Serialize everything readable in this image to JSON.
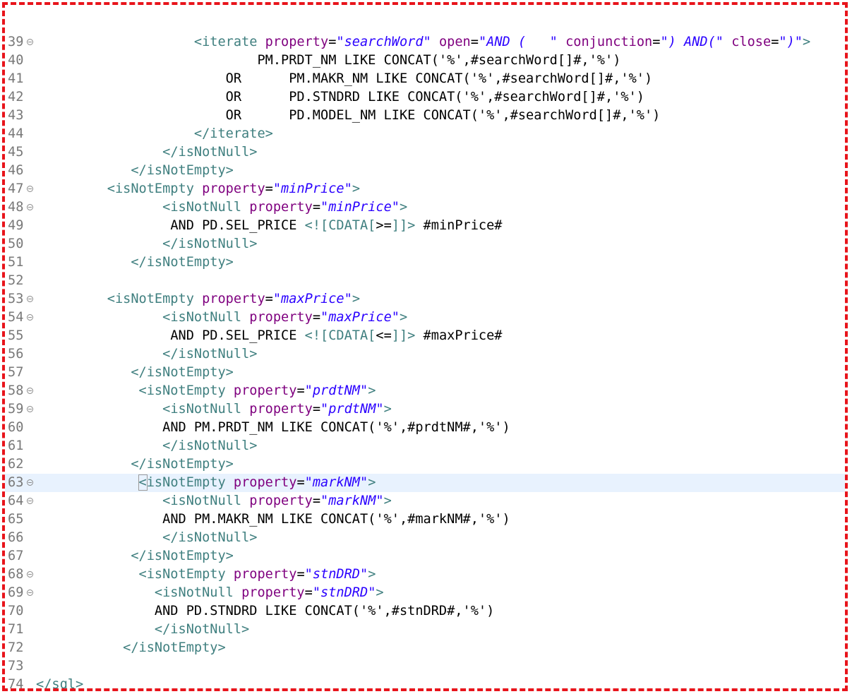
{
  "editor": {
    "language": "xml",
    "current_line": 63,
    "lines": [
      {
        "num": "39",
        "fold": true,
        "segs": [
          [
            "t",
            "<iterate "
          ],
          [
            "a",
            "property"
          ],
          [
            "x",
            "="
          ],
          [
            "v",
            "\"searchWord\""
          ],
          [
            "x",
            " "
          ],
          [
            "a",
            "open"
          ],
          [
            "x",
            "="
          ],
          [
            "v",
            "\"AND (   \""
          ],
          [
            "x",
            " "
          ],
          [
            "a",
            "conjunction"
          ],
          [
            "x",
            "="
          ],
          [
            "v",
            "\") AND(\""
          ],
          [
            "x",
            " "
          ],
          [
            "a",
            "close"
          ],
          [
            "x",
            "="
          ],
          [
            "v",
            "\")\""
          ],
          [
            "t",
            ">"
          ]
        ],
        "indent": "                    "
      },
      {
        "num": "40",
        "fold": false,
        "segs": [
          [
            "x",
            "PM.PRDT_NM LIKE CONCAT('%',#searchWord[]#,'%')"
          ]
        ],
        "indent": "                            "
      },
      {
        "num": "41",
        "fold": false,
        "segs": [
          [
            "x",
            "OR      PM.MAKR_NM LIKE CONCAT('%',#searchWord[]#,'%')"
          ]
        ],
        "indent": "                        "
      },
      {
        "num": "42",
        "fold": false,
        "segs": [
          [
            "x",
            "OR      PD.STNDRD LIKE CONCAT('%',#searchWord[]#,'%')"
          ]
        ],
        "indent": "                        "
      },
      {
        "num": "43",
        "fold": false,
        "segs": [
          [
            "x",
            "OR      PD.MODEL_NM LIKE CONCAT('%',#searchWord[]#,'%')"
          ]
        ],
        "indent": "                        "
      },
      {
        "num": "44",
        "fold": false,
        "segs": [
          [
            "t",
            "</iterate>"
          ]
        ],
        "indent": "                    "
      },
      {
        "num": "45",
        "fold": false,
        "segs": [
          [
            "t",
            "</isNotNull>"
          ]
        ],
        "indent": "                "
      },
      {
        "num": "46",
        "fold": false,
        "segs": [
          [
            "t",
            "</isNotEmpty>"
          ]
        ],
        "indent": "            "
      },
      {
        "num": "47",
        "fold": true,
        "segs": [
          [
            "t",
            "<isNotEmpty "
          ],
          [
            "a",
            "property"
          ],
          [
            "x",
            "="
          ],
          [
            "v",
            "\"minPrice\""
          ],
          [
            "t",
            ">"
          ]
        ],
        "indent": "         "
      },
      {
        "num": "48",
        "fold": true,
        "segs": [
          [
            "t",
            "<isNotNull "
          ],
          [
            "a",
            "property"
          ],
          [
            "x",
            "="
          ],
          [
            "v",
            "\"minPrice\""
          ],
          [
            "t",
            ">"
          ]
        ],
        "indent": "                "
      },
      {
        "num": "49",
        "fold": false,
        "segs": [
          [
            "x",
            "AND PD.SEL_PRICE "
          ],
          [
            "t",
            "<![CDATA["
          ],
          [
            "x",
            ">="
          ],
          [
            "t",
            "]]>"
          ],
          [
            "x",
            " #minPrice#"
          ]
        ],
        "indent": "                 "
      },
      {
        "num": "50",
        "fold": false,
        "segs": [
          [
            "t",
            "</isNotNull>"
          ]
        ],
        "indent": "                "
      },
      {
        "num": "51",
        "fold": false,
        "segs": [
          [
            "t",
            "</isNotEmpty>"
          ]
        ],
        "indent": "            "
      },
      {
        "num": "52",
        "fold": false,
        "segs": [],
        "indent": ""
      },
      {
        "num": "53",
        "fold": true,
        "segs": [
          [
            "t",
            "<isNotEmpty "
          ],
          [
            "a",
            "property"
          ],
          [
            "x",
            "="
          ],
          [
            "v",
            "\"maxPrice\""
          ],
          [
            "t",
            ">"
          ]
        ],
        "indent": "         "
      },
      {
        "num": "54",
        "fold": true,
        "segs": [
          [
            "t",
            "<isNotNull "
          ],
          [
            "a",
            "property"
          ],
          [
            "x",
            "="
          ],
          [
            "v",
            "\"maxPrice\""
          ],
          [
            "t",
            ">"
          ]
        ],
        "indent": "                "
      },
      {
        "num": "55",
        "fold": false,
        "segs": [
          [
            "x",
            "AND PD.SEL_PRICE "
          ],
          [
            "t",
            "<![CDATA["
          ],
          [
            "x",
            "<="
          ],
          [
            "t",
            "]]>"
          ],
          [
            "x",
            " #maxPrice#"
          ]
        ],
        "indent": "                 "
      },
      {
        "num": "56",
        "fold": false,
        "segs": [
          [
            "t",
            "</isNotNull>"
          ]
        ],
        "indent": "                "
      },
      {
        "num": "57",
        "fold": false,
        "segs": [
          [
            "t",
            "</isNotEmpty>"
          ]
        ],
        "indent": "            "
      },
      {
        "num": "58",
        "fold": true,
        "segs": [
          [
            "t",
            "<isNotEmpty "
          ],
          [
            "a",
            "property"
          ],
          [
            "x",
            "="
          ],
          [
            "v",
            "\"prdtNM\""
          ],
          [
            "t",
            ">"
          ]
        ],
        "indent": "             "
      },
      {
        "num": "59",
        "fold": true,
        "segs": [
          [
            "t",
            "<isNotNull "
          ],
          [
            "a",
            "property"
          ],
          [
            "x",
            "="
          ],
          [
            "v",
            "\"prdtNM\""
          ],
          [
            "t",
            ">"
          ]
        ],
        "indent": "                "
      },
      {
        "num": "60",
        "fold": false,
        "segs": [
          [
            "x",
            "AND PM.PRDT_NM LIKE CONCAT('%',#prdtNM#,'%')"
          ]
        ],
        "indent": "                "
      },
      {
        "num": "61",
        "fold": false,
        "segs": [
          [
            "t",
            "</isNotNull>"
          ]
        ],
        "indent": "                "
      },
      {
        "num": "62",
        "fold": false,
        "segs": [
          [
            "t",
            "</isNotEmpty>"
          ]
        ],
        "indent": "            "
      },
      {
        "num": "63",
        "fold": true,
        "segs": [
          [
            "t",
            "<isNotEmpty "
          ],
          [
            "a",
            "property"
          ],
          [
            "x",
            "="
          ],
          [
            "v",
            "\"markNM\""
          ],
          [
            "t",
            ">"
          ]
        ],
        "indent": "             "
      },
      {
        "num": "64",
        "fold": true,
        "segs": [
          [
            "t",
            "<isNotNull "
          ],
          [
            "a",
            "property"
          ],
          [
            "x",
            "="
          ],
          [
            "v",
            "\"markNM\""
          ],
          [
            "t",
            ">"
          ]
        ],
        "indent": "                "
      },
      {
        "num": "65",
        "fold": false,
        "segs": [
          [
            "x",
            "AND PM.MAKR_NM LIKE CONCAT('%',#markNM#,'%')"
          ]
        ],
        "indent": "                "
      },
      {
        "num": "66",
        "fold": false,
        "segs": [
          [
            "t",
            "</isNotNull>"
          ]
        ],
        "indent": "                "
      },
      {
        "num": "67",
        "fold": false,
        "segs": [
          [
            "t",
            "</isNotEmpty>"
          ]
        ],
        "indent": "            "
      },
      {
        "num": "68",
        "fold": true,
        "segs": [
          [
            "t",
            "<isNotEmpty "
          ],
          [
            "a",
            "property"
          ],
          [
            "x",
            "="
          ],
          [
            "v",
            "\"stnDRD\""
          ],
          [
            "t",
            ">"
          ]
        ],
        "indent": "             "
      },
      {
        "num": "69",
        "fold": true,
        "segs": [
          [
            "t",
            "<isNotNull "
          ],
          [
            "a",
            "property"
          ],
          [
            "x",
            "="
          ],
          [
            "v",
            "\"stnDRD\""
          ],
          [
            "t",
            ">"
          ]
        ],
        "indent": "               "
      },
      {
        "num": "70",
        "fold": false,
        "segs": [
          [
            "x",
            "AND PD.STNDRD LIKE CONCAT('%',#stnDRD#,'%')"
          ]
        ],
        "indent": "               "
      },
      {
        "num": "71",
        "fold": false,
        "segs": [
          [
            "t",
            "</isNotNull>"
          ]
        ],
        "indent": "               "
      },
      {
        "num": "72",
        "fold": false,
        "segs": [
          [
            "t",
            "</isNotEmpty>"
          ]
        ],
        "indent": "           "
      },
      {
        "num": "73",
        "fold": false,
        "segs": [],
        "indent": ""
      },
      {
        "num": "74",
        "fold": false,
        "segs": [
          [
            "t",
            "</sql>"
          ]
        ],
        "indent": ""
      }
    ]
  },
  "colors": {
    "tag": "#3f7f7f",
    "attribute": "#7f007f",
    "value": "#2a00ff",
    "text": "#000000",
    "line_number": "#787878",
    "current_line_bg": "#e8f2fe",
    "frame_border": "#e8141b"
  }
}
